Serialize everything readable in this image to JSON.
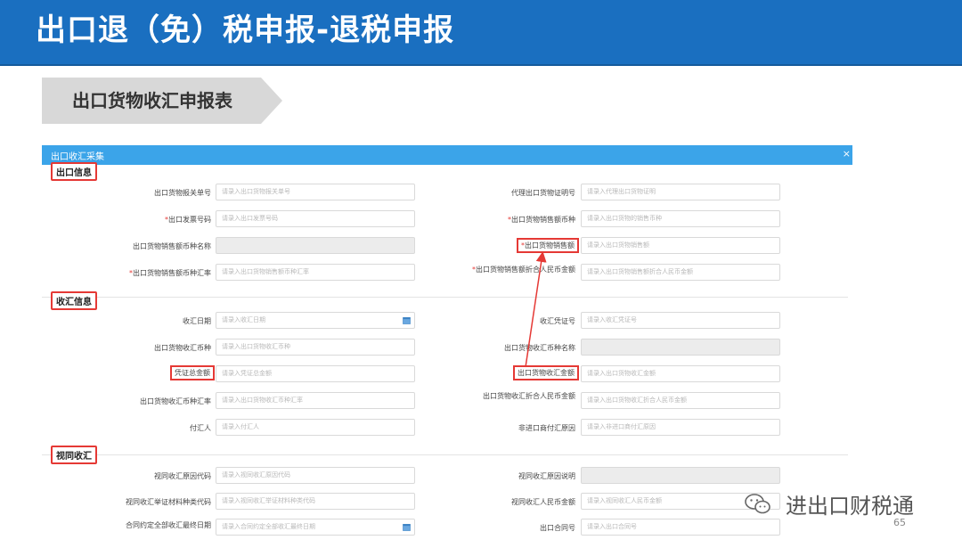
{
  "banner": {
    "title": "出口退（免）税申报-退税申报"
  },
  "subtitle": {
    "label": "出口货物收汇申报表"
  },
  "panel": {
    "title": "出口收汇采集",
    "close": "×"
  },
  "sections": {
    "export_info": "出口信息",
    "receipt_info": "收汇信息",
    "deemed_receipt": "视同收汇"
  },
  "form": {
    "r1_left_label": "出口货物报关单号",
    "r1_left_placeholder": "请录入出口货物报关单号",
    "r1_right_label": "代理出口货物证明号",
    "r1_right_placeholder": "请录入代理出口货物证明",
    "r2_left_label": "出口发票号码",
    "r2_left_placeholder": "请录入出口发票号码",
    "r2_right_label": "出口货物销售额币种",
    "r2_right_placeholder": "请录入出口货物的销售币种",
    "r3_left_label": "出口货物销售额币种名称",
    "r3_right_label": "出口货物销售额",
    "r3_right_placeholder": "请录入出口货物销售额",
    "r4_left_label": "出口货物销售额币种汇率",
    "r4_left_placeholder": "请录入出口货物销售额币种汇率",
    "r4_right_label": "出口货物销售额折合人民币金额",
    "r4_right_placeholder": "请录入出口货物销售额折合人民币金额",
    "r5_left_label": "收汇日期",
    "r5_left_placeholder": "请录入收汇日期",
    "r5_right_label": "收汇凭证号",
    "r5_right_placeholder": "请录入收汇凭证号",
    "r6_left_label": "出口货物收汇币种",
    "r6_left_placeholder": "请录入出口货物收汇币种",
    "r6_right_label": "出口货物收汇币种名称",
    "r7_left_label": "凭证总金额",
    "r7_left_placeholder": "请录入凭证总金额",
    "r7_right_label": "出口货物收汇金额",
    "r7_right_placeholder": "请录入出口货物收汇金额",
    "r8_left_label": "出口货物收汇币种汇率",
    "r8_left_placeholder": "请录入出口货物收汇币种汇率",
    "r8_right_label": "出口货物收汇折合人民币金额",
    "r8_right_placeholder": "请录入出口货物收汇折合人民币金额",
    "r9_left_label": "付汇人",
    "r9_left_placeholder": "请录入付汇人",
    "r9_right_label": "非进口商付汇原因",
    "r9_right_placeholder": "请录入非进口商付汇原因",
    "r10_left_label": "视同收汇原因代码",
    "r10_left_placeholder": "请录入视同收汇原因代码",
    "r10_right_label": "视同收汇原因说明",
    "r11_left_label": "视同收汇举证材料种类代码",
    "r11_left_placeholder": "请录入视同收汇举证材料种类代码",
    "r11_right_label": "视同收汇人民币金额",
    "r11_right_placeholder": "请录入视同收汇人民币金额",
    "r12_left_label": "合同约定全部收汇最终日期",
    "r12_left_placeholder": "请录入合同约定全部收汇最终日期",
    "r12_right_label": "出口合同号",
    "r12_right_placeholder": "请录入出口合同号"
  },
  "footer": {
    "page": "65",
    "watermark": "进出口财税通"
  }
}
